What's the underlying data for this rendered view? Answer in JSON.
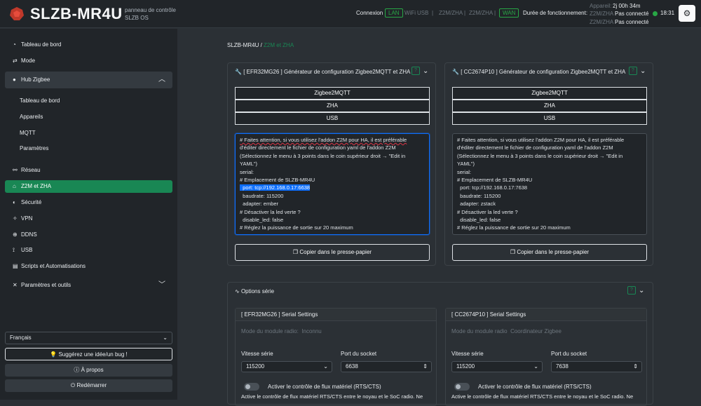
{
  "header": {
    "brand": "SLZB-MR4U",
    "subtitle_line1": "panneau de contrôle",
    "subtitle_line2": "SLZB OS",
    "connection_label": "Connexion",
    "conn_lan": "LAN",
    "conn_wifi": "WiFi",
    "conn_usb": "USB",
    "sep": "|",
    "conn_z2m_1": "Z2M/ZHA",
    "conn_z2m_2": "Z2M/ZHA",
    "conn_wan": "WAN",
    "uptime_label": "Durée de fonctionnement:",
    "device_label": "Appareil:",
    "device_uptime": "2j 00h 34m",
    "z2m_label_1": "Z2M/ZHA",
    "z2m_status_1": "Pas connecté",
    "z2m_label_2": "Z2M/ZHA",
    "z2m_status_2": "Pas connecté",
    "clock": "18:31",
    "theme_icon": "gear-icon",
    "accent": "#198754"
  },
  "sidebar": {
    "items": [
      {
        "label": "Tableau de bord",
        "icon": "dashboard-icon"
      },
      {
        "label": "Mode",
        "icon": "arrows-icon"
      },
      {
        "label": "Hub Zigbee",
        "icon": "zigbee-icon"
      },
      {
        "label": "Tableau de bord"
      },
      {
        "label": "Appareils"
      },
      {
        "label": "MQTT"
      },
      {
        "label": "Paramètres"
      },
      {
        "label": "Réseau",
        "icon": "network-icon"
      },
      {
        "label": "Z2M et ZHA",
        "icon": "home-icon"
      },
      {
        "label": "Sécurité",
        "icon": "shield-icon"
      },
      {
        "label": "VPN",
        "icon": "vpn-icon"
      },
      {
        "label": "DDNS",
        "icon": "ddns-icon"
      },
      {
        "label": "USB",
        "icon": "usb-icon"
      },
      {
        "label": "Scripts et Automatisations",
        "icon": "script-icon"
      },
      {
        "label": "Paramètres et outils",
        "icon": "tools-icon"
      }
    ],
    "language": "Français",
    "suggest_btn": "Suggérez une idée/un bug !",
    "about_btn": "À propos",
    "restart_btn": "Redémarrer"
  },
  "breadcrumb": {
    "root": "SLZB-MR4U",
    "sep": "/",
    "current": "Z2M et ZHA"
  },
  "generators": [
    {
      "title": "[ EFR32MG26 ] Générateur de configuration Zigbee2MQTT et ZHA",
      "options": [
        "Zigbee2MQTT",
        "ZHA",
        "USB"
      ],
      "copy_btn": "Copier dans le presse-papier",
      "code": {
        "l1": "# Faites attention, si vous utilisez l'addon Z2M pour HA, il est préférable",
        "l2": "d'éditer directement le fichier de configuration yaml de l'addon Z2M",
        "l3": "(Sélectionnez le menu à 3 points dans le coin supérieur droit → \"Edit in",
        "l4": "YAML\")",
        "l5": "serial:",
        "l6": "# Emplacement de SLZB-MR4U",
        "l7": "  port: tcp://192.168.0.17:6638",
        "l8": "  baudrate: 115200",
        "l9": "  adapter: ember",
        "l10": "# Désactiver la led verte ?",
        "l11": "  disable_led: false",
        "l12": "# Réglez la puissance de sortie sur 20 maximum"
      }
    },
    {
      "title": "[ CC2674P10 ] Générateur de configuration Zigbee2MQTT et ZHA",
      "options": [
        "Zigbee2MQTT",
        "ZHA",
        "USB"
      ],
      "copy_btn": "Copier dans le presse-papier",
      "code": {
        "l1": "# Faites attention, si vous utilisez l'addon Z2M pour HA, il est préférable",
        "l2": "d'éditer directement le fichier de configuration yaml de l'addon Z2M",
        "l3": "(Sélectionnez le menu à 3 points dans le coin supérieur droit → \"Edit in",
        "l4": "YAML\")",
        "l5": "serial:",
        "l6": "# Emplacement de SLZB-MR4U",
        "l7": "  port: tcp://192.168.0.17:7638",
        "l8": "  baudrate: 115200",
        "l9": "  adapter: zstack",
        "l10": "# Désactiver la led verte ?",
        "l11": "  disable_led: false",
        "l12": "# Réglez la puissance de sortie sur 20 maximum"
      }
    }
  ],
  "serial_options": {
    "title": "Options série",
    "panels": [
      {
        "title": "[ EFR32MG26 ] Serial Settings",
        "radio_mode_label": "Mode du module radio:",
        "radio_mode_value": "Inconnu",
        "baud_label": "Vitesse série",
        "baud_value": "115200",
        "port_label": "Port du socket",
        "port_value": "6638",
        "flow_label": "Activer le contrôle de flux matériel (RTS/CTS)",
        "flow_desc": "Active le contrôle de flux matériel RTS/CTS entre le noyau et le SoC radio. Ne",
        "flow_enabled": false
      },
      {
        "title": "[ CC2674P10 ] Serial Settings",
        "radio_mode_label": "Mode du module radio",
        "radio_mode_value": "Coordinateur Zigbee",
        "baud_label": "Vitesse série",
        "baud_value": "115200",
        "port_label": "Port du socket",
        "port_value": "7638",
        "flow_label": "Activer le contrôle de flux matériel (RTS/CTS)",
        "flow_desc": "Active le contrôle de flux matériel RTS/CTS entre le noyau et le SoC radio. Ne",
        "flow_enabled": false
      }
    ]
  }
}
